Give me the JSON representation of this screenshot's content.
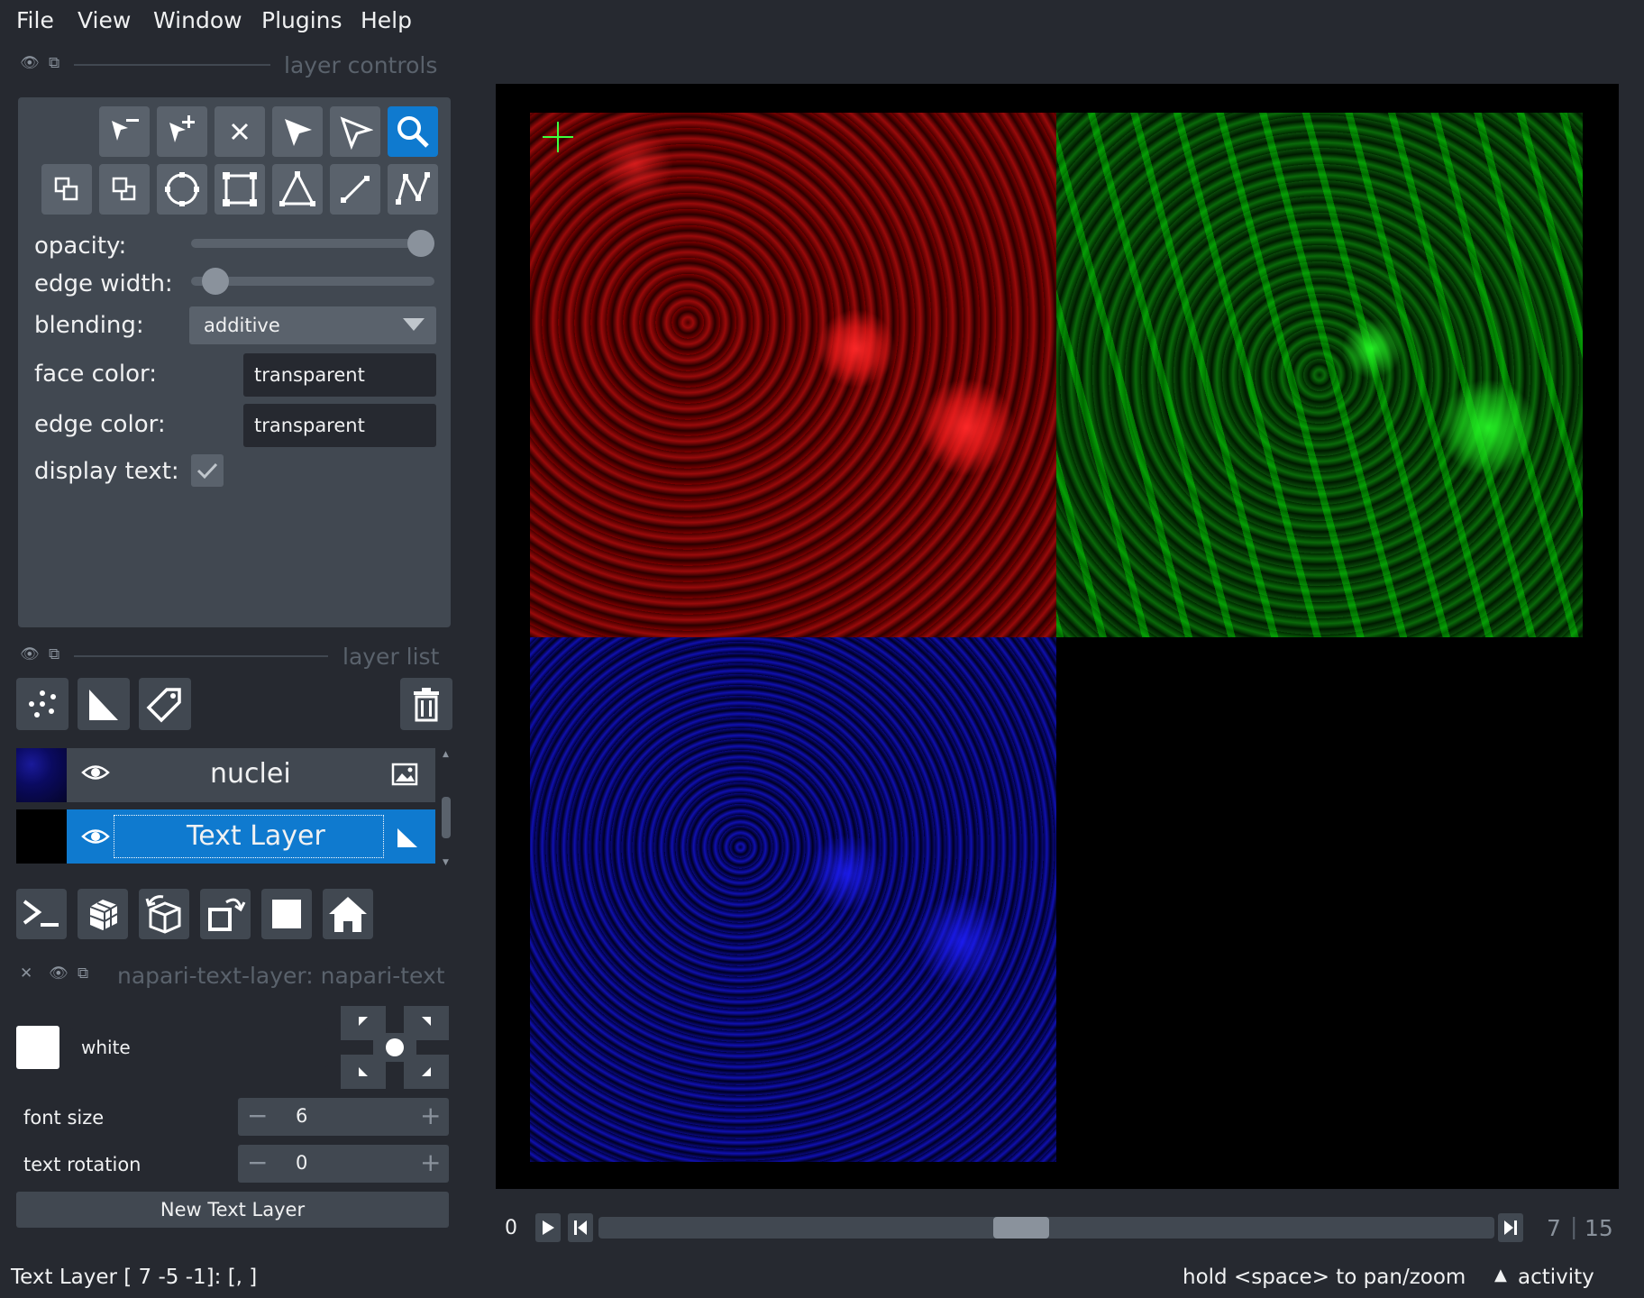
{
  "menu": [
    "File",
    "View",
    "Window",
    "Plugins",
    "Help"
  ],
  "dock_layer_controls": {
    "title": "layer controls"
  },
  "controls": {
    "opacity_label": "opacity:",
    "opacity_value": 1.0,
    "edge_width_label": "edge width:",
    "edge_width_value": 0.05,
    "blending_label": "blending:",
    "blending_value": "additive",
    "face_color_label": "face color:",
    "face_color_value": "transparent",
    "edge_color_label": "edge color:",
    "edge_color_value": "transparent",
    "display_text_label": "display text:",
    "display_text_checked": true
  },
  "dock_layer_list": {
    "title": "layer list"
  },
  "layers": [
    {
      "name": "nuclei",
      "type": "image",
      "visible": true,
      "selected": false
    },
    {
      "name": "Text Layer",
      "type": "shapes",
      "visible": true,
      "selected": true
    }
  ],
  "plugin": {
    "title": "napari-text-layer: napari-text",
    "color_name": "white",
    "font_size_label": "font size",
    "font_size_value": "6",
    "text_rotation_label": "text rotation",
    "text_rotation_value": "0",
    "new_layer_button": "New Text Layer"
  },
  "dims": {
    "axis_label": "0",
    "current": "7",
    "separator": "|",
    "total": "15",
    "position_fraction": 0.47
  },
  "status": {
    "left": "Text Layer [ 7 -5 -1]: [, ]",
    "hint": "hold <space> to pan/zoom",
    "activity": "activity"
  },
  "colors": {
    "background": "#262930",
    "panel": "#414851",
    "button": "#5a626c",
    "accent": "#0f7acf",
    "red_channel": "#ff0000",
    "green_channel": "#00ff00",
    "blue_channel": "#0000ff"
  },
  "icons": {
    "tools": [
      "remove-point-icon",
      "add-point-icon",
      "delete-icon",
      "select-icon",
      "direct-select-icon",
      "zoom-icon",
      "move-back-icon",
      "move-front-icon",
      "ellipse-icon",
      "rectangle-icon",
      "polygon-icon",
      "line-icon",
      "path-icon"
    ],
    "layer_buttons": [
      "new-points-icon",
      "new-shapes-icon",
      "new-labels-icon",
      "delete-layer-icon"
    ],
    "viewer_buttons": [
      "console-icon",
      "ndisplay-icon",
      "roll-icon",
      "transpose-icon",
      "grid-icon",
      "home-icon"
    ]
  }
}
